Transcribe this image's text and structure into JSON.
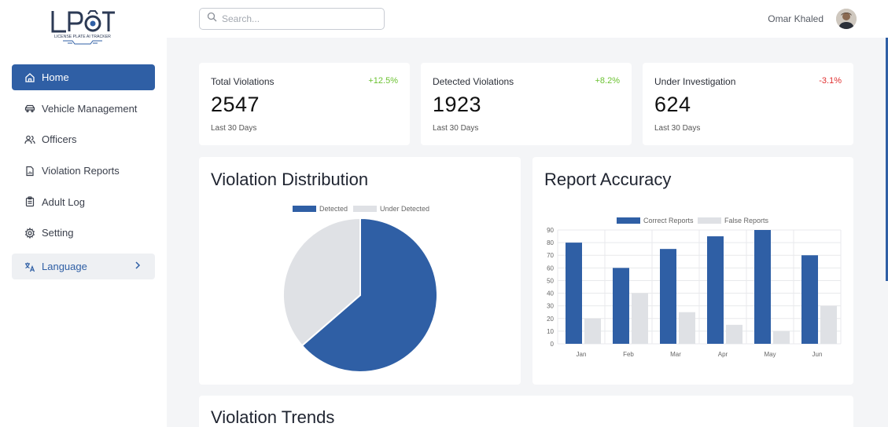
{
  "app": {
    "logo_text": "LPAT",
    "logo_subtitle": "LICENSE PLATE AI TRACKER"
  },
  "search": {
    "placeholder": "Search..."
  },
  "user": {
    "name": "Omar Khaled"
  },
  "sidebar": {
    "items": [
      {
        "label": "Home",
        "icon": "home-icon",
        "active": true
      },
      {
        "label": "Vehicle Management",
        "icon": "car-icon"
      },
      {
        "label": "Officers",
        "icon": "users-icon"
      },
      {
        "label": "Violation Reports",
        "icon": "document-icon"
      },
      {
        "label": "Adult Log",
        "icon": "clipboard-icon"
      },
      {
        "label": "Setting",
        "icon": "gear-icon"
      }
    ],
    "language": {
      "label": "Language",
      "icon": "translate-icon"
    }
  },
  "stats": [
    {
      "label": "Total Violations",
      "change": "+12.5%",
      "value": "2547",
      "period": "Last 30 Days"
    },
    {
      "label": "Detected Violations",
      "change": "+8.2%",
      "value": "1923",
      "period": "Last 30 Days"
    },
    {
      "label": "Under Investigation",
      "change": "-3.1%",
      "value": "624",
      "period": "Last 30 Days"
    }
  ],
  "colors": {
    "accent": "#2f5fa5",
    "muted": "#dfe1e5",
    "positive": "#6bc231",
    "negative": "#e03131"
  },
  "panels": {
    "distribution_title": "Violation Distribution",
    "accuracy_title": "Report Accuracy",
    "trends_title": "Violation Trends"
  },
  "chart_data": [
    {
      "type": "pie",
      "title": "Violation Distribution",
      "labels": [
        "Detected",
        "Under Detected"
      ],
      "values": [
        1923,
        1100
      ],
      "colors": [
        "#2f5fa5",
        "#dfe1e5"
      ],
      "legend": "top"
    },
    {
      "type": "bar",
      "title": "Report Accuracy",
      "categories": [
        "Jan",
        "Feb",
        "Mar",
        "Apr",
        "May",
        "Jun"
      ],
      "series": [
        {
          "name": "Correct Reports",
          "values": [
            80,
            60,
            75,
            85,
            90,
            70
          ],
          "color": "#2f5fa5"
        },
        {
          "name": "False Reports",
          "values": [
            20,
            40,
            25,
            15,
            10,
            30
          ],
          "color": "#dfe1e5"
        }
      ],
      "ylim": [
        0,
        90
      ],
      "yticks": [
        0,
        10,
        20,
        30,
        40,
        50,
        60,
        70,
        80,
        90
      ],
      "grid": true,
      "legend": "top"
    }
  ]
}
